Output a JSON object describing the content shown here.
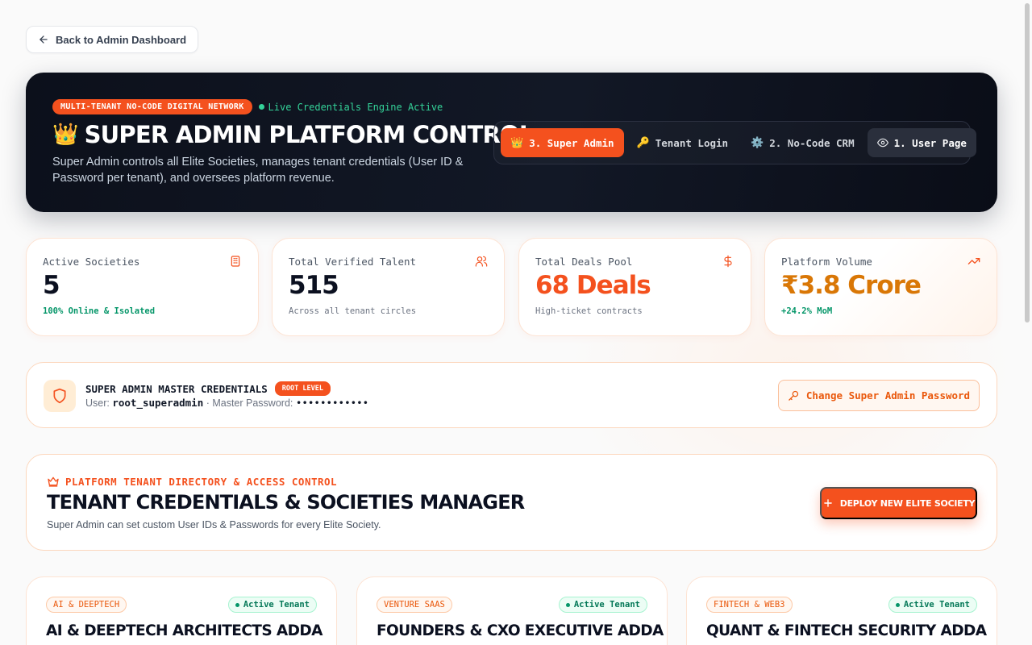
{
  "back_button": {
    "label": "Back to Admin Dashboard"
  },
  "hero": {
    "badge": "MULTI-TENANT NO-CODE DIGITAL NETWORK",
    "live_status": "Live Credentials Engine Active",
    "crown_emoji": "👑",
    "title": "SUPER ADMIN PLATFORM CONTROL",
    "description": "Super Admin controls all Elite Societies, manages tenant credentials (User ID & Password per tenant), and oversees platform revenue.",
    "tabs": [
      {
        "icon": "👑",
        "label": "3. Super Admin"
      },
      {
        "icon": "🔑",
        "label": "Tenant Login"
      },
      {
        "icon": "⚙️",
        "label": "2. No-Code CRM"
      },
      {
        "label": "1. User Page"
      }
    ]
  },
  "stats": [
    {
      "label": "Active Societies",
      "value": "5",
      "sub": "100% Online & Isolated"
    },
    {
      "label": "Total Verified Talent",
      "value": "515",
      "sub": "Across all tenant circles"
    },
    {
      "label": "Total Deals Pool",
      "value": "68 Deals",
      "sub": "High-ticket contracts"
    },
    {
      "label": "Platform Volume",
      "value": "₹3.8 Crore",
      "sub": "+24.2% MoM"
    }
  ],
  "credentials": {
    "title": "SUPER ADMIN MASTER CREDENTIALS",
    "badge": "ROOT LEVEL",
    "user_prefix": "User: ",
    "user": "root_superadmin",
    "password_prefix": " · Master Password: ",
    "password_mask": "••••••••••••",
    "change_button": "Change Super Admin Password"
  },
  "directory": {
    "eyebrow": "PLATFORM TENANT DIRECTORY & ACCESS CONTROL",
    "title": "TENANT CREDENTIALS & SOCIETIES MANAGER",
    "description": "Super Admin can set custom User IDs & Passwords for every Elite Society.",
    "deploy_button": "DEPLOY NEW ELITE SOCIETY"
  },
  "societies": [
    {
      "tag": "AI & DEEPTECH",
      "status": "Active Tenant",
      "name": "AI & DEEPTECH ARCHITECTS ADDA"
    },
    {
      "tag": "VENTURE SAAS",
      "status": "Active Tenant",
      "name": "FOUNDERS & CXO EXECUTIVE ADDA"
    },
    {
      "tag": "FINTECH & WEB3",
      "status": "Active Tenant",
      "name": "QUANT & FINTECH SECURITY ADDA"
    }
  ],
  "colors": {
    "accent": "#f4511e",
    "hero_bg": "#0c101b",
    "success": "#059669",
    "amber_value": "#d97706"
  }
}
